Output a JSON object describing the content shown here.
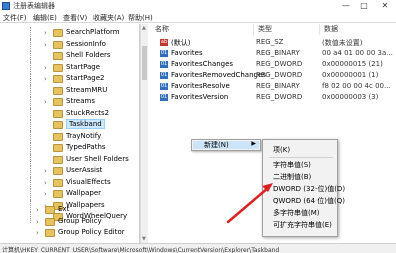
{
  "window": {
    "title": "注册表编辑器",
    "min": "—",
    "max": "□",
    "close": "✕"
  },
  "menu": [
    "文件(F)",
    "编辑(E)",
    "查看(V)",
    "收藏夹(A)",
    "帮助(H)"
  ],
  "tree": {
    "items": [
      {
        "label": "SearchPlatform",
        "expander": "›"
      },
      {
        "label": "SessionInfo",
        "expander": "›"
      },
      {
        "label": "Shell Folders",
        "expander": ""
      },
      {
        "label": "StartPage",
        "expander": "›"
      },
      {
        "label": "StartPage2",
        "expander": "›"
      },
      {
        "label": "StreamMRU",
        "expander": ""
      },
      {
        "label": "Streams",
        "expander": "›"
      },
      {
        "label": "StuckRects2",
        "expander": ""
      },
      {
        "label": "Taskband",
        "expander": "",
        "selected": true
      },
      {
        "label": "TrayNotify",
        "expander": ""
      },
      {
        "label": "TypedPaths",
        "expander": ""
      },
      {
        "label": "User Shell Folders",
        "expander": ""
      },
      {
        "label": "UserAssist",
        "expander": "›"
      },
      {
        "label": "VisualEffects",
        "expander": "›"
      },
      {
        "label": "Wallpaper",
        "expander": "›"
      },
      {
        "label": "Wallpapers",
        "expander": "›"
      },
      {
        "label": "WordWheelQuery",
        "expander": ""
      }
    ],
    "lower_items": [
      {
        "label": "Ext",
        "expander": "›"
      },
      {
        "label": "Group Policy",
        "expander": "›"
      },
      {
        "label": "Group Policy Editor",
        "expander": "›"
      }
    ]
  },
  "columns": {
    "name": "名称",
    "type": "类型",
    "data": "数据"
  },
  "values": [
    {
      "icon": "ab",
      "name": "(默认)",
      "type": "REG_SZ",
      "data": "(数值未设置)"
    },
    {
      "icon": "bin",
      "name": "Favorites",
      "type": "REG_BINARY",
      "data": "00 a4 01 00 00 3a..."
    },
    {
      "icon": "bin",
      "name": "FavoritesChanges",
      "type": "REG_DWORD",
      "data": "0x00000015 (21)"
    },
    {
      "icon": "bin",
      "name": "FavoritesRemovedChanges",
      "type": "REG_DWORD",
      "data": "0x00000001 (1)"
    },
    {
      "icon": "bin",
      "name": "FavoritesResolve",
      "type": "REG_BINARY",
      "data": "f8 02 00 00 4c 00..."
    },
    {
      "icon": "bin",
      "name": "FavoritesVersion",
      "type": "REG_DWORD",
      "data": "0x00000003 (3)"
    }
  ],
  "context_menu": {
    "label": "新建(N)",
    "arrow": "▶"
  },
  "submenu": {
    "items": [
      "项(K)",
      "字符串值(S)",
      "二进制值(B)",
      "DWORD (32-位)值(D)",
      "QWORD (64 位)值(Q)",
      "多字符串值(M)",
      "可扩充字符串值(E)"
    ]
  },
  "status": {
    "path": "计算机\\HKEY_CURRENT_USER\\Software\\Microsoft\\Windows\\CurrentVersion\\Explorer\\Taskband"
  },
  "colors": {
    "annotation_arrow": "#e02020",
    "selection": "#cce8ff"
  }
}
